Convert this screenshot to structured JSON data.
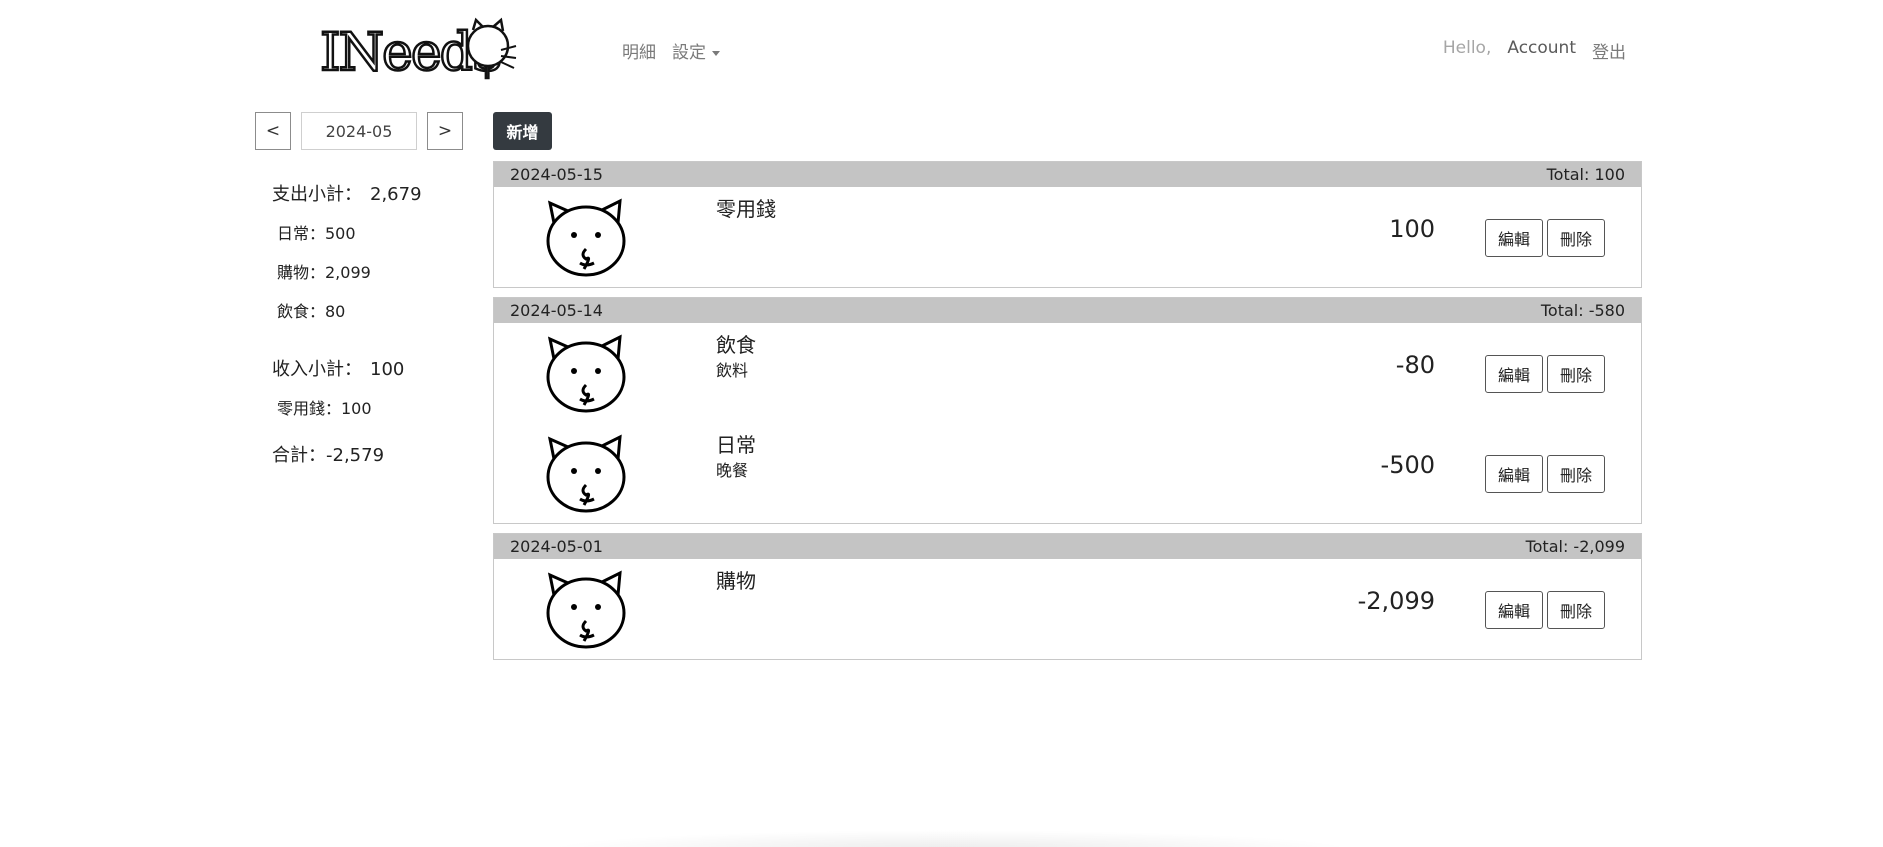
{
  "nav": {
    "logo_text": "INeed$",
    "links": [
      "明細",
      "設定"
    ],
    "hello": "Hello,",
    "account": "Account",
    "logout": "登出"
  },
  "month": {
    "prev": "<",
    "value": "2024-05",
    "next": ">"
  },
  "summary": {
    "expense_label": "支出小計：",
    "expense_total": "2,679",
    "expense_items": [
      "日常：500",
      "購物：2,099",
      "飲食：80"
    ],
    "income_label": "收入小計：",
    "income_total": "100",
    "income_items": [
      "零用錢：100"
    ],
    "total": "合計：-2,579"
  },
  "add_label": "新增",
  "buttons": {
    "edit": "編輯",
    "delete": "刪除"
  },
  "days": [
    {
      "date": "2024-05-15",
      "total": "Total: 100",
      "entries": [
        {
          "category": "零用錢",
          "note": "",
          "amount": "100"
        }
      ]
    },
    {
      "date": "2024-05-14",
      "total": "Total: -580",
      "entries": [
        {
          "category": "飲食",
          "note": "飲料",
          "amount": "-80"
        },
        {
          "category": "日常",
          "note": "晚餐",
          "amount": "-500"
        }
      ]
    },
    {
      "date": "2024-05-01",
      "total": "Total: -2,099",
      "entries": [
        {
          "category": "購物",
          "note": "",
          "amount": "-2,099"
        }
      ]
    }
  ]
}
